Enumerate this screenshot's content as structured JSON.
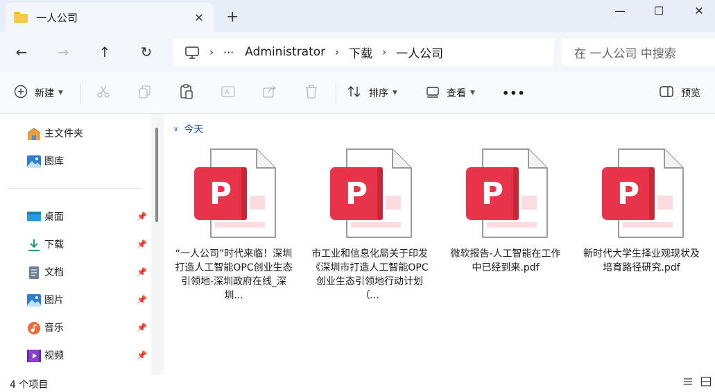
{
  "window": {
    "tab_title": "一人公司",
    "tab_close": "✕",
    "new_tab": "+",
    "minimize": "—",
    "maximize": "☐",
    "close": "✕"
  },
  "nav": {
    "back": "←",
    "forward": "→",
    "up": "↑",
    "refresh": "↻",
    "breadcrumb": [
      "Administrator",
      "下载",
      "一人公司"
    ],
    "more": "···",
    "separator": "›",
    "search_placeholder": "在 一人公司 中搜索"
  },
  "toolbar": {
    "new_label": "新建",
    "sort_label": "排序",
    "view_label": "查看",
    "more_label": "•••",
    "preview_label": "预览"
  },
  "sidebar": {
    "quick": [
      {
        "label": "主文件夹",
        "icon": "home-icon"
      },
      {
        "label": "图库",
        "icon": "gallery-icon"
      }
    ],
    "pinned": [
      {
        "label": "桌面",
        "icon": "desktop-icon"
      },
      {
        "label": "下载",
        "icon": "download-icon"
      },
      {
        "label": "文档",
        "icon": "document-icon"
      },
      {
        "label": "图片",
        "icon": "pictures-icon"
      },
      {
        "label": "音乐",
        "icon": "music-icon"
      },
      {
        "label": "视频",
        "icon": "video-icon"
      }
    ]
  },
  "content": {
    "group_label": "今天",
    "files": [
      {
        "name": "“一人公司”时代来临！深圳打造人工智能OPC创业生态引领地-深圳政府在线_深圳..."
      },
      {
        "name": "市工业和信息化局关于印发《深圳市打造人工智能OPC创业生态引领地行动计划（..."
      },
      {
        "name": "微软报告-人工智能在工作中已经到来.pdf"
      },
      {
        "name": "新时代大学生择业观现状及培育路径研究.pdf"
      }
    ]
  },
  "status": {
    "item_count": "4 个项目"
  },
  "colors": {
    "accent": "#1f4e99",
    "pdf_red": "#e8344a",
    "folder_yellow": "#f7c948"
  }
}
